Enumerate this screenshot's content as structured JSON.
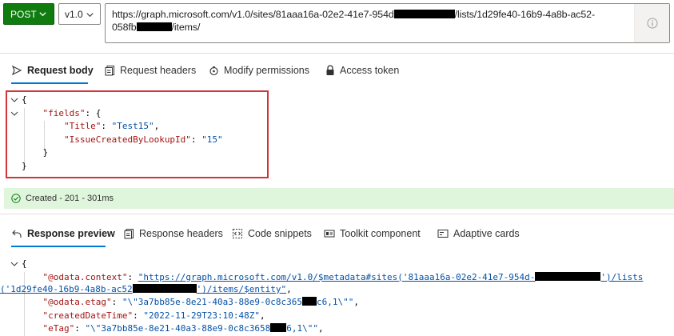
{
  "request_bar": {
    "method": "POST",
    "version": "v1.0",
    "url_line1_a": "https://graph.microsoft.com/v1.0/sites/81aaa16a-02e2-41e7-954d",
    "url_line1_b": "/lists/1d29fe40-16b9-4a8b-ac52-",
    "url_line2_a": "058fb",
    "url_line2_b": "/items/",
    "icons": {
      "method_chevron": "chevron-down-icon",
      "version_chevron": "chevron-down-icon",
      "info": "info-icon"
    }
  },
  "request_tabs": [
    {
      "label": "Request body",
      "icon": "send-icon",
      "selected": true
    },
    {
      "label": "Request headers",
      "icon": "headers-icon",
      "selected": false
    },
    {
      "label": "Modify permissions",
      "icon": "permissions-icon",
      "selected": false
    },
    {
      "label": "Access token",
      "icon": "lock-icon",
      "selected": false
    }
  ],
  "request_body": {
    "open_brace": "{",
    "fields_key": "\"fields\"",
    "fields_open": ": {",
    "title_key": "\"Title\"",
    "title_value": "\"Test15\"",
    "lookup_key": "\"IssueCreatedByLookupId\"",
    "lookup_value": "\"15\"",
    "inner_close": "}",
    "close_brace": "}"
  },
  "status": {
    "text": "Created - 201 - 301ms",
    "icon": "check-circle-icon",
    "color": "#107c10",
    "background": "#dff6dd"
  },
  "response_tabs": [
    {
      "label": "Response preview",
      "icon": "reply-icon",
      "selected": true
    },
    {
      "label": "Response headers",
      "icon": "headers-icon",
      "selected": false
    },
    {
      "label": "Code snippets",
      "icon": "code-icon",
      "selected": false
    },
    {
      "label": "Toolkit component",
      "icon": "toolkit-icon",
      "selected": false
    },
    {
      "label": "Adaptive cards",
      "icon": "card-icon",
      "selected": false
    }
  ],
  "response_preview": {
    "open_brace": "{",
    "odata_context_key": "\"@odata.context\"",
    "odata_context_value_a": "\"https://graph.microsoft.com/v1.0/$metadata#sites('81aaa16a-02e2-41e7-954d-",
    "odata_context_value_b": "')/lists",
    "odata_context_value_c": "('1d29fe40-16b9-4a8b-ac52",
    "odata_context_value_d": "')/items/$entity\"",
    "odata_etag_key": "\"@odata.etag\"",
    "odata_etag_value_a": "\"\\\"3a7bb85e-8e21-40a3-88e9-0c8c365",
    "odata_etag_value_b": "c6,1\\\"\"",
    "created_key": "\"createdDateTime\"",
    "created_value": "\"2022-11-29T23:10:48Z\"",
    "etag_key": "\"eTag\"",
    "etag_value_a": "\"\\\"3a7bb85e-8e21-40a3-88e9-0c8c3658",
    "etag_value_b": "6,1\\\"\""
  },
  "colors": {
    "accent": "#0078d4",
    "post_green": "#107c10",
    "highlight_red": "#d13438",
    "json_key": "#a31515",
    "json_string": "#0451a5"
  }
}
